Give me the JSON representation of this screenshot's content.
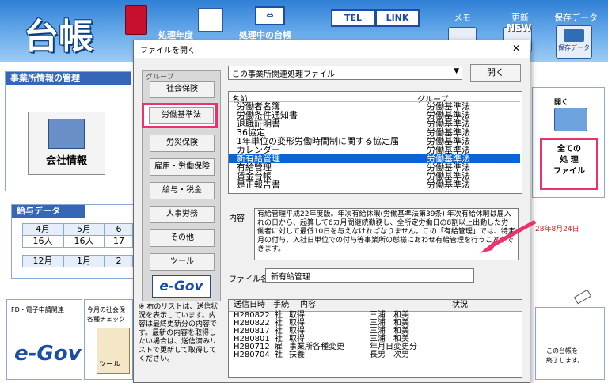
{
  "header": {
    "logo": "台帳",
    "fiscal_year_label": "処理年度",
    "current_ledger_label": "処理中の台帳",
    "tel_button": "TEL",
    "link_button": "LINK",
    "memo_label": "メモ",
    "update_label": "更新",
    "save_label": "保存データ",
    "save_button": "保存データ",
    "new_badge": "NEW"
  },
  "office_panel": {
    "title": "事業所情報の管理",
    "company_button": "会社情報"
  },
  "salary_panel": {
    "title": "給与データ",
    "months_row1": [
      "4月",
      "5月",
      "6"
    ],
    "counts_row1": [
      "16人",
      "16人",
      "17"
    ],
    "months_row2": [
      "12月",
      "1月",
      "2"
    ]
  },
  "right_panel": {
    "open_label": "開く",
    "all_files_button": "全ての\n処 理\nファイル",
    "date_text": "28年8月24日"
  },
  "bottom": {
    "fd_label": "FD・電子申請関連",
    "egov_label": "e-Gov",
    "check_label_1": "今月の社会保",
    "check_label_2": "各種チェック",
    "tool_label": "ツール",
    "exit_text_1": "この台帳を",
    "exit_text_2": "終了します。"
  },
  "dialog": {
    "title": "ファイルを開く",
    "close_glyph": "✕",
    "group_label": "グループ",
    "groups": [
      "社会保険",
      "労働基準法",
      "労災保険",
      "雇用・労働保険",
      "給与・税金",
      "人事労務",
      "その他",
      "ツール"
    ],
    "egov_logo": "e-Gov",
    "dropdown_value": "この事業所関連処理ファイル",
    "open_button": "開く",
    "col_name": "名前",
    "col_group": "グループ",
    "files": [
      {
        "name": "労働者名簿",
        "group": "労働基準法"
      },
      {
        "name": "労働条件通知書",
        "group": "労働基準法"
      },
      {
        "name": "退職証明書",
        "group": "労働基準法"
      },
      {
        "name": "36協定",
        "group": "労働基準法"
      },
      {
        "name": "1年単位の変形労働時間制に関する協定届",
        "group": "労働基準法"
      },
      {
        "name": "カレンダー",
        "group": "労働基準法"
      },
      {
        "name": "新有給管理",
        "group": "労働基準法"
      },
      {
        "name": "有給管理",
        "group": "労働基準法"
      },
      {
        "name": "賃金台帳",
        "group": "労働基準法"
      },
      {
        "name": "是正報告書",
        "group": "労働基準法"
      }
    ],
    "content_label": "内容",
    "content_text": "有給管理平成22年度版。年次有給休暇(労働基準法第39条) 年次有給休暇は雇入れの日から、起算して6カ月間継続勤務し、全所定労働日の8割以上出勤した労働者に対して最低10日を与えなければなりません。この「有給管理」では、特定月の付与、入社日単位での付与等事業所の態様にあわせ有給管理を行うことができます。",
    "filename_label": "ファイル名",
    "filename_value": "新有給管理",
    "note_text": "※ 右のリストは、送信状況を表示しています。内容は最終更新分の内容です。最新の内容を取得したい場合は、送信済みリストで更新して取得してください。",
    "hist_headers": [
      "送信日時",
      "手続",
      "内容",
      "状況"
    ],
    "history": [
      {
        "date": "H280822",
        "proc": "社",
        "content": "取得",
        "person": "三浦　和美"
      },
      {
        "date": "H280822",
        "proc": "社",
        "content": "取得",
        "person": "三浦　和美"
      },
      {
        "date": "H280817",
        "proc": "社",
        "content": "取得",
        "person": "三浦　和美"
      },
      {
        "date": "H280801",
        "proc": "社",
        "content": "取得",
        "person": "三浦　和美"
      },
      {
        "date": "H280712",
        "proc": "雇",
        "content": "事業所各種変更",
        "person": "年月日変更分"
      },
      {
        "date": "H280704",
        "proc": "社",
        "content": "扶養",
        "person": "長男　次男"
      }
    ]
  },
  "colors": {
    "highlight": "#e8336e",
    "selection": "#0a64d6",
    "header_blue": "#2f7fd6"
  }
}
